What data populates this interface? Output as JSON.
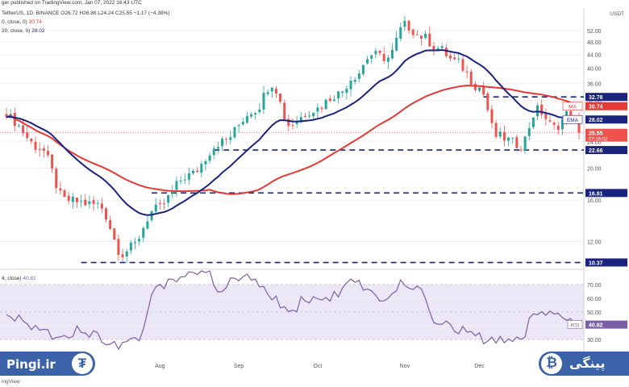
{
  "header": {
    "line1": "ger published on TradingView.com, Jan 07, 2022 16:43 UTC",
    "line2_prefix": "TetherUS, 1D, BINANCE",
    "line2_ohlc": "O26.72 H26.86 L24.24 C25.55 −1.17 (−4.38%)",
    "line3_label": "0, close, 0)",
    "line3_value": "30.74",
    "line4_label": "20, close, 0)",
    "line4_value": "28.02",
    "rsi_label": "4, close)",
    "rsi_value": "40.82"
  },
  "currency_label": "USDT",
  "footer_text": "ingView",
  "brand": {
    "left_name": "Pingi.ir",
    "left_coin_icon": "tether-icon",
    "left_coin_glyph": "₮",
    "right_name": "پینگی",
    "right_coin_icon": "bitcoin-icon",
    "right_coin_glyph": "₿",
    "color": "#3b62a8"
  },
  "colors": {
    "up": "#26a69a",
    "down": "#ef5350",
    "ma": "#e53935",
    "ema": "#1a237e",
    "rsi": "#7b5ea7",
    "rsi_band": "#ece7f6",
    "level": "#1a237e"
  },
  "chart_data": [
    {
      "type": "candlestick",
      "price_axis": {
        "scale": "log",
        "ticks": [
          12.0,
          16.0,
          20.0,
          24.0,
          28.0,
          32.0,
          36.0,
          40.0,
          44.0,
          48.0,
          52.0
        ],
        "range": [
          10.0,
          57.5
        ]
      },
      "x_ticks": [
        "Aug",
        "Sep",
        "Oct",
        "Nov",
        "Dec",
        "2022"
      ],
      "price_tags": [
        {
          "label": "",
          "value": 32.78,
          "kind": "level"
        },
        {
          "label": "MA",
          "value": 30.74,
          "kind": "ma"
        },
        {
          "label": "EMA",
          "value": 28.02,
          "kind": "ema"
        },
        {
          "label": "",
          "value": 25.55,
          "kind": "last",
          "sub": "07:16:02"
        },
        {
          "label": "",
          "value": 22.66,
          "kind": "level"
        },
        {
          "label": "",
          "value": 16.81,
          "kind": "level"
        },
        {
          "label": "",
          "value": 10.37,
          "kind": "level"
        }
      ],
      "horizontal_levels": [
        {
          "value": 32.78,
          "from_day": 115
        },
        {
          "value": 22.66,
          "from_day": 50
        },
        {
          "value": 16.81,
          "from_day": 35
        },
        {
          "value": 10.37,
          "from_day": 18
        }
      ],
      "last_price": 25.55,
      "series": [
        {
          "name": "MA",
          "indicator": "sma",
          "last": 30.74
        },
        {
          "name": "EMA",
          "indicator": "ema",
          "last": 28.02
        }
      ],
      "close_anchors": [
        [
          0,
          28.5
        ],
        [
          8,
          23.0
        ],
        [
          14,
          16.0
        ],
        [
          22,
          15.5
        ],
        [
          28,
          11.0
        ],
        [
          30,
          11.5
        ],
        [
          36,
          15.0
        ],
        [
          44,
          19.0
        ],
        [
          52,
          24.0
        ],
        [
          60,
          30.0
        ],
        [
          64,
          36.0
        ],
        [
          68,
          27.0
        ],
        [
          74,
          30.0
        ],
        [
          80,
          33.5
        ],
        [
          84,
          38.0
        ],
        [
          88,
          44.0
        ],
        [
          92,
          43.0
        ],
        [
          96,
          54.0
        ],
        [
          100,
          50.0
        ],
        [
          104,
          46.0
        ],
        [
          108,
          42.0
        ],
        [
          114,
          35.0
        ],
        [
          118,
          25.0
        ],
        [
          124,
          23.5
        ],
        [
          128,
          30.0
        ],
        [
          132,
          26.5
        ],
        [
          136,
          29.5
        ],
        [
          138,
          25.55
        ]
      ]
    },
    {
      "type": "line",
      "indicator": "RSI",
      "ylim": [
        20,
        80
      ],
      "y_ticks": [
        30.0,
        40.0,
        50.0,
        60.0,
        70.0
      ],
      "band": [
        30,
        70
      ],
      "series": [
        {
          "name": "RSI",
          "last": 40.82
        }
      ],
      "anchors": [
        [
          0,
          48
        ],
        [
          6,
          40
        ],
        [
          12,
          33
        ],
        [
          18,
          37
        ],
        [
          24,
          30
        ],
        [
          28,
          26
        ],
        [
          32,
          32
        ],
        [
          36,
          68
        ],
        [
          40,
          74
        ],
        [
          44,
          79
        ],
        [
          48,
          80
        ],
        [
          52,
          66
        ],
        [
          56,
          76
        ],
        [
          60,
          72
        ],
        [
          64,
          62
        ],
        [
          68,
          48
        ],
        [
          72,
          60
        ],
        [
          76,
          58
        ],
        [
          80,
          64
        ],
        [
          84,
          72
        ],
        [
          88,
          63
        ],
        [
          92,
          60
        ],
        [
          96,
          72
        ],
        [
          100,
          64
        ],
        [
          104,
          42
        ],
        [
          108,
          38
        ],
        [
          112,
          34
        ],
        [
          116,
          28
        ],
        [
          120,
          30
        ],
        [
          124,
          32
        ],
        [
          128,
          52
        ],
        [
          132,
          48
        ],
        [
          136,
          44
        ],
        [
          138,
          40.82
        ]
      ]
    }
  ]
}
